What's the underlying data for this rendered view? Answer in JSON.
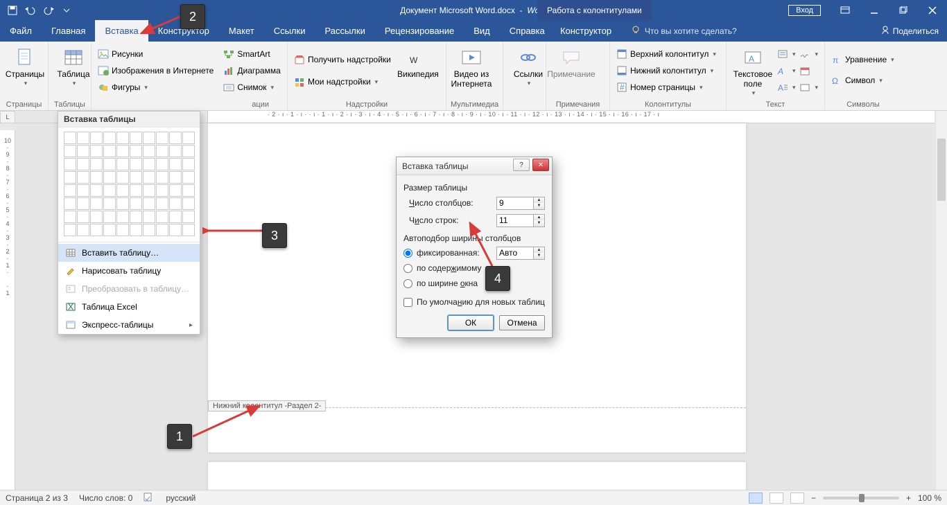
{
  "title": {
    "doc": "Документ Microsoft Word.docx",
    "app": "Word",
    "context": "Работа с колонтитулами"
  },
  "titlebar": {
    "login": "Вход"
  },
  "tabs": {
    "file": "Файл",
    "home": "Главная",
    "insert": "Вставка",
    "design": "Конструктор",
    "layout": "Макет",
    "references": "Ссылки",
    "mailings": "Рассылки",
    "review": "Рецензирование",
    "view": "Вид",
    "help": "Справка",
    "hf_design": "Конструктор",
    "tellme": "Что вы хотите сделать?",
    "share": "Поделиться"
  },
  "ribbon": {
    "pages": {
      "label": "Страницы",
      "btn": "Страницы"
    },
    "tables": {
      "label": "Таблицы",
      "btn": "Таблица"
    },
    "illustrations": {
      "label": "Иллюстрации",
      "pic": "Рисунки",
      "online": "Изображения в Интернете",
      "shapes": "Фигуры",
      "smartart": "SmartArt",
      "chart": "Диаграмма",
      "screenshot": "Снимок"
    },
    "addins": {
      "label": "Надстройки",
      "get": "Получить надстройки",
      "my": "Мои надстройки",
      "wiki": "Википедия"
    },
    "media": {
      "label": "Мультимедиа",
      "video": "Видео из Интернета"
    },
    "links": {
      "label": "",
      "btn": "Ссылки"
    },
    "comments": {
      "label": "Примечания",
      "btn": "Примечание"
    },
    "headerfooter": {
      "label": "Колонтитулы",
      "header": "Верхний колонтитул",
      "footer": "Нижний колонтитул",
      "page": "Номер страницы"
    },
    "text": {
      "label": "Текст",
      "textbox": "Текстовое поле"
    },
    "symbols": {
      "label": "Символы",
      "equation": "Уравнение",
      "symbol": "Символ"
    }
  },
  "ruler": {
    "corner": "L",
    "horiz": "· 2 · ı · 1 · ı ·   · ı · 1 · ı · 2 · ı · 3 · ı · 4 · ı · 5 · ı · 6 · ı · 7 · ı · 8 · ı · 9 · ı · 10 · ı · 11 · ı · 12 · ı · 13 · ı · 14 · ı · 15 · ı · 16 · ı · 17 · ı"
  },
  "table_dd": {
    "header": "Вставка таблицы",
    "insert": "Вставить таблицу…",
    "draw": "Нарисовать таблицу",
    "convert": "Преобразовать в таблицу…",
    "excel": "Таблица Excel",
    "quick": "Экспресс-таблицы"
  },
  "dialog": {
    "title": "Вставка таблицы",
    "size": "Размер таблицы",
    "cols_label": "Число столбцов:",
    "cols_value": "9",
    "rows_label": "Число строк:",
    "rows_value": "11",
    "autofit": "Автоподбор ширины столбцов",
    "fixed": "фиксированная:",
    "fixed_value": "Авто",
    "by_content": "по содержимому",
    "by_window": "по ширине окна",
    "remember": "По умолчанию для новых таблиц",
    "ok": "ОК",
    "cancel": "Отмена"
  },
  "footer_tag": "Нижний колонтитул -Раздел 2-",
  "markers": {
    "m1": "1",
    "m2": "2",
    "m3": "3",
    "m4": "4"
  },
  "status": {
    "page": "Страница 2 из 3",
    "words": "Число слов: 0",
    "lang": "русский",
    "zoom": "100 %",
    "plus": "+",
    "minus": "−"
  }
}
